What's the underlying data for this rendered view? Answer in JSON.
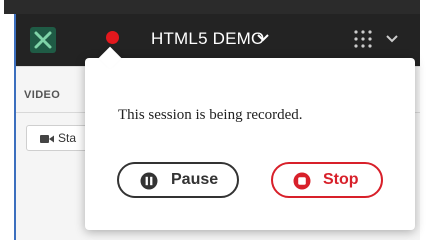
{
  "navbar": {
    "session_title": "HTML5 DEMO",
    "recording_indicator_color": "#e3181d",
    "logo_icon": "webex-logo-icon",
    "title_menu_icon": "chevron-down-icon",
    "apps_icon": "grid-dots-icon",
    "apps_menu_icon": "chevron-down-icon"
  },
  "sidebar": {
    "section_label": "VIDEO",
    "start_video_label": "Sta",
    "camera_icon": "camera-icon"
  },
  "recording_popover": {
    "message": "This session is being recorded.",
    "pause_label": "Pause",
    "pause_icon": "pause-circle-icon",
    "stop_label": "Stop",
    "stop_icon": "stop-circle-icon",
    "stop_color": "#d8202a"
  }
}
